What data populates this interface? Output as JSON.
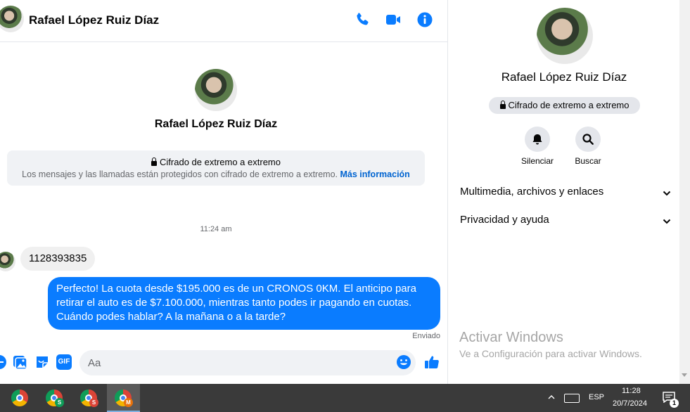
{
  "contact": {
    "name": "Rafael López Ruiz Díaz"
  },
  "header": {
    "icons": [
      "phone-icon",
      "video-camera-icon",
      "info-icon"
    ],
    "accent_color": "#0a7cff"
  },
  "encryption": {
    "title": "Cifrado de extremo a extremo",
    "description": "Los mensajes y las llamadas están protegidos con cifrado de extremo a extremo.",
    "link": "Más información"
  },
  "conversation": {
    "timestamp": "11:24 am",
    "incoming_message": "1128393835",
    "outgoing_message": "Perfecto! La cuota desde $195.000 es de un CRONOS 0KM. El anticipo para retirar el auto es de $7.100.000, mientras tanto podes ir pagando en cuotas. Cuándo podes hablar? A la mañana o a la tarde?",
    "sent_status": "Enviado"
  },
  "composer": {
    "placeholder": "Aa",
    "icons": [
      "plus-icon",
      "image-icon",
      "sticker-icon",
      "gif-icon",
      "emoji-icon",
      "thumbs-up-icon"
    ],
    "gif_label": "GIF"
  },
  "sidebar": {
    "name": "Rafael López Ruiz Díaz",
    "encryption_badge": "Cifrado de extremo a extremo",
    "actions": [
      {
        "label": "Silenciar",
        "icon": "bell-icon"
      },
      {
        "label": "Buscar",
        "icon": "search-icon"
      }
    ],
    "sections": [
      {
        "label": "Multimedia, archivos y enlaces"
      },
      {
        "label": "Privacidad y ayuda"
      }
    ]
  },
  "watermark": {
    "title": "Activar Windows",
    "subtitle": "Ve a Configuración para activar Windows."
  },
  "taskbar": {
    "apps": [
      {
        "name": "chrome",
        "badge": ""
      },
      {
        "name": "chrome",
        "badge": "S",
        "badge_color": "#0f9d58"
      },
      {
        "name": "chrome",
        "badge": "S",
        "badge_color": "#db4437"
      },
      {
        "name": "chrome",
        "badge": "M",
        "badge_color": "#e8710a"
      }
    ],
    "language": "ESP",
    "time": "11:28",
    "date": "20/7/2024",
    "notification_count": "1"
  }
}
